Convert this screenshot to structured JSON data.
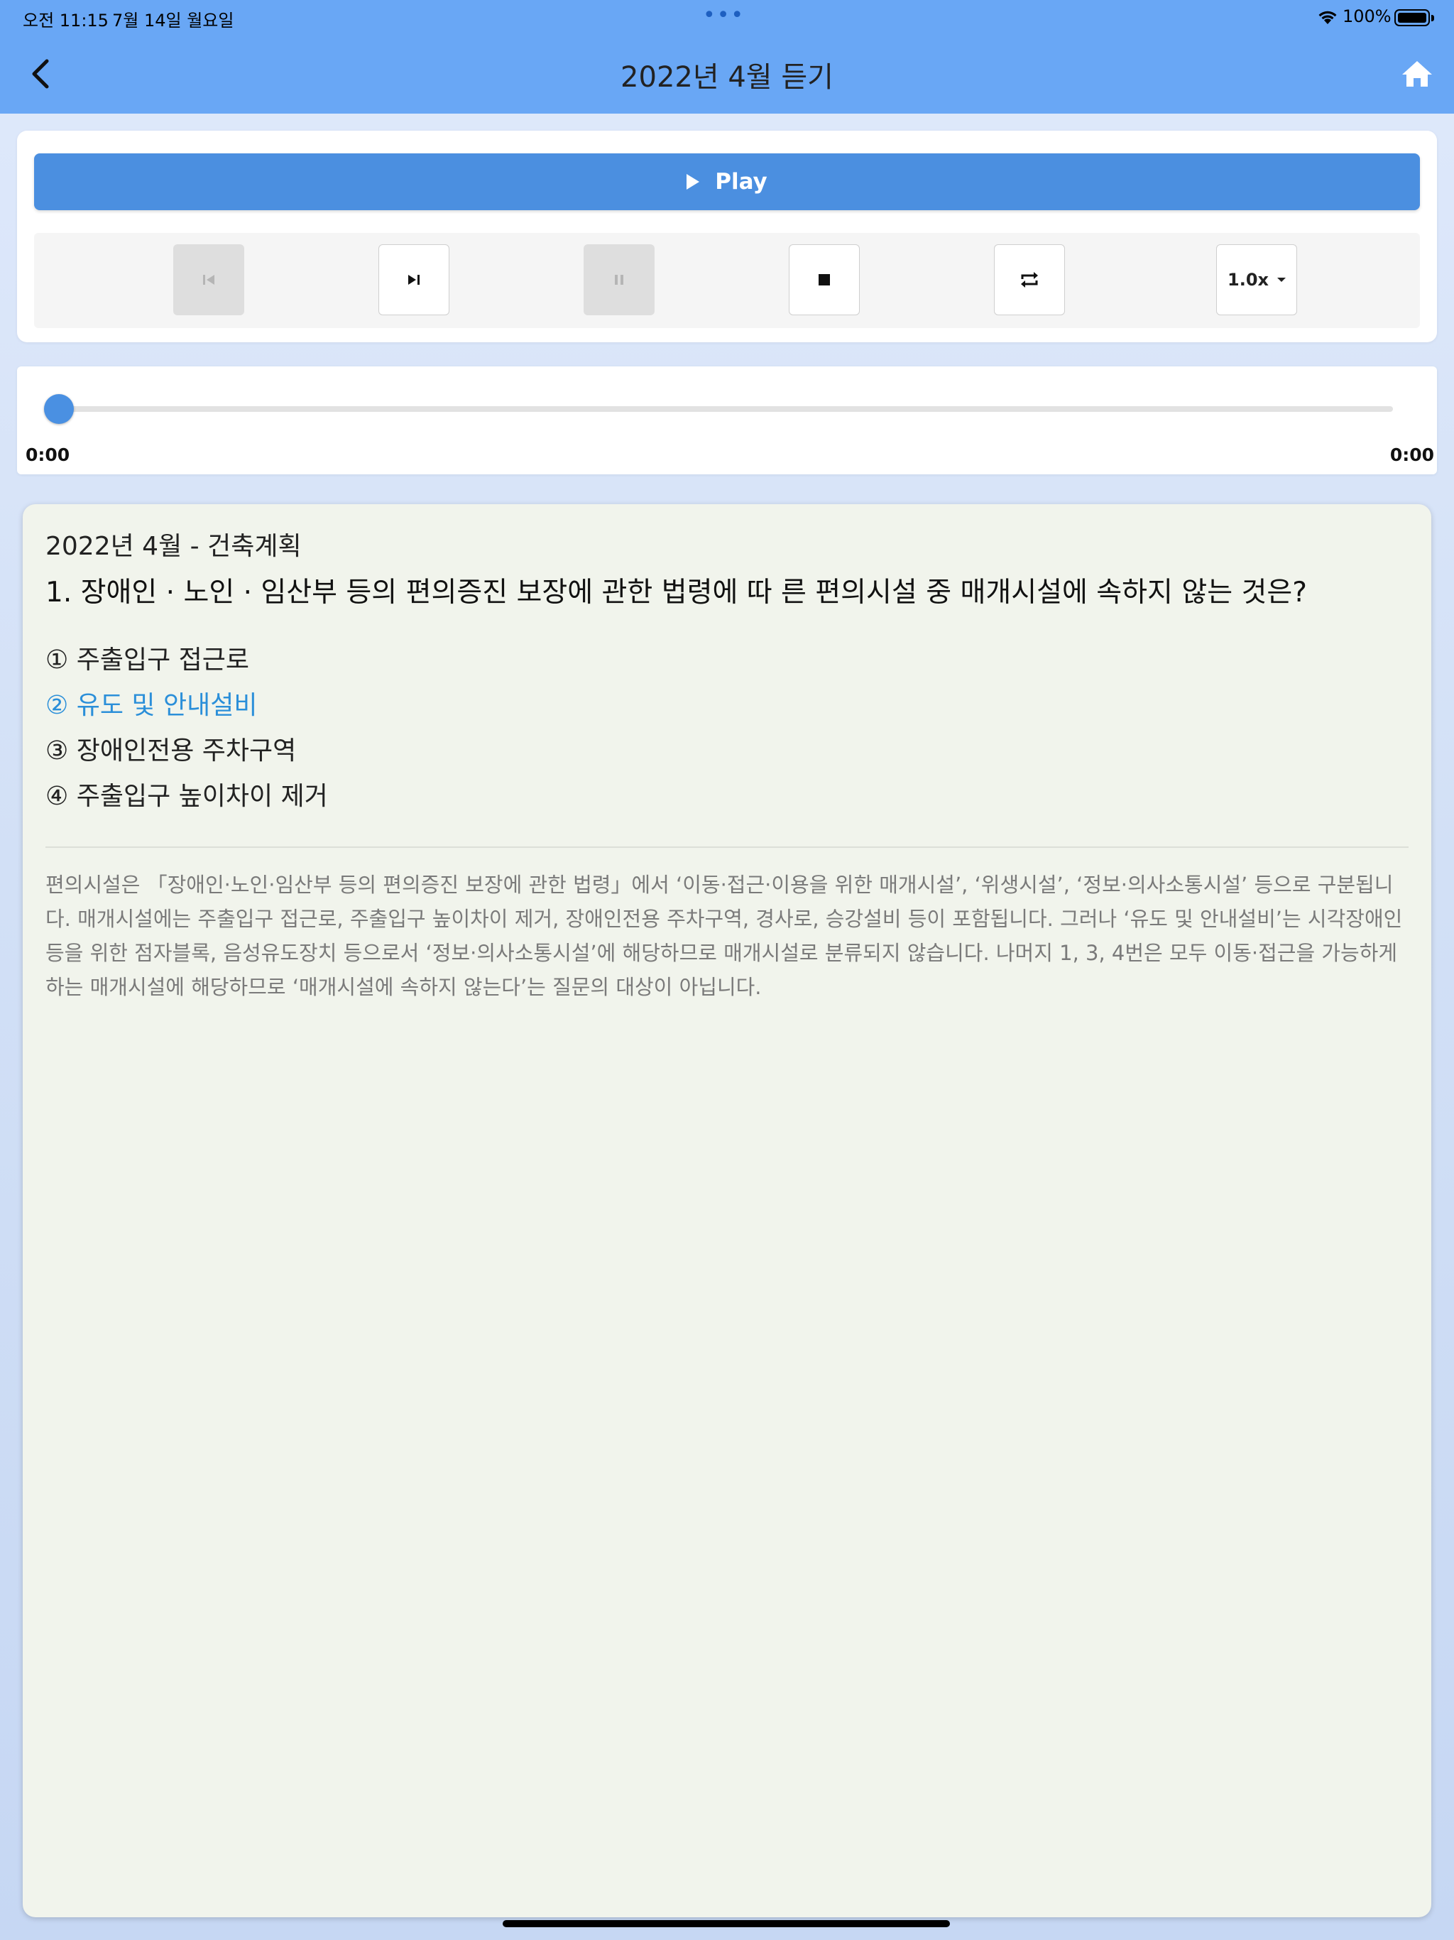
{
  "status_bar": {
    "time": "오전 11:15",
    "date": "7월 14일 월요일",
    "battery": "100%",
    "icons": [
      "wifi-icon",
      "battery-icon",
      "multitask-dots-icon"
    ]
  },
  "nav": {
    "title": "2022년 4월 듣기",
    "back_icon": "chevron-left-icon",
    "home_icon": "home-icon"
  },
  "player": {
    "play_label": "Play",
    "controls": [
      {
        "name": "previous-button",
        "icon": "skip-previous-icon",
        "enabled": false
      },
      {
        "name": "next-button",
        "icon": "skip-next-icon",
        "enabled": true
      },
      {
        "name": "pause-button",
        "icon": "pause-icon",
        "enabled": false
      },
      {
        "name": "stop-button",
        "icon": "stop-icon",
        "enabled": true
      },
      {
        "name": "repeat-button",
        "icon": "repeat-icon",
        "enabled": true
      }
    ],
    "speed": "1.0x",
    "current_time": "0:00",
    "total_time": "0:00",
    "progress": 0
  },
  "question": {
    "subject": "2022년 4월 - 건축계획",
    "text": "1. 장애인 · 노인 · 임산부 등의 편의증진 보장에 관한 법령에 따 른 편의시설 중 매개시설에 속하지 않는 것은?",
    "options": [
      {
        "label": "① 주출입구 접근로",
        "correct": false
      },
      {
        "label": "② 유도 및 안내설비",
        "correct": true
      },
      {
        "label": "③ 장애인전용 주차구역",
        "correct": false
      },
      {
        "label": "④ 주출입구 높이차이 제거",
        "correct": false
      }
    ],
    "explanation": "편의시설은 「장애인·노인·임산부 등의 편의증진 보장에 관한 법령」에서 ‘이동·접근·이용을 위한 매개시설’, ‘위생시설’, ‘정보·의사소통시설’ 등으로 구분됩니다. 매개시설에는 주출입구 접근로, 주출입구 높이차이 제거, 장애인전용 주차구역, 경사로, 승강설비 등이 포함됩니다. 그러나 ‘유도 및 안내설비’는 시각장애인 등을 위한 점자블록, 음성유도장치 등으로서 ‘정보·의사소통시설’에 해당하므로 매개시설로 분류되지 않습니다. 나머지 1, 3, 4번은 모두 이동·접근을 가능하게 하는 매개시설에 해당하므로 ‘매개시설에 속하지 않는다’는 질문의 대상이 아닙니다."
  },
  "colors": {
    "header": "#69a7f5",
    "play_button": "#4b8fe0",
    "correct_option": "#2b8fd9",
    "question_bg": "#f1f4ec"
  }
}
